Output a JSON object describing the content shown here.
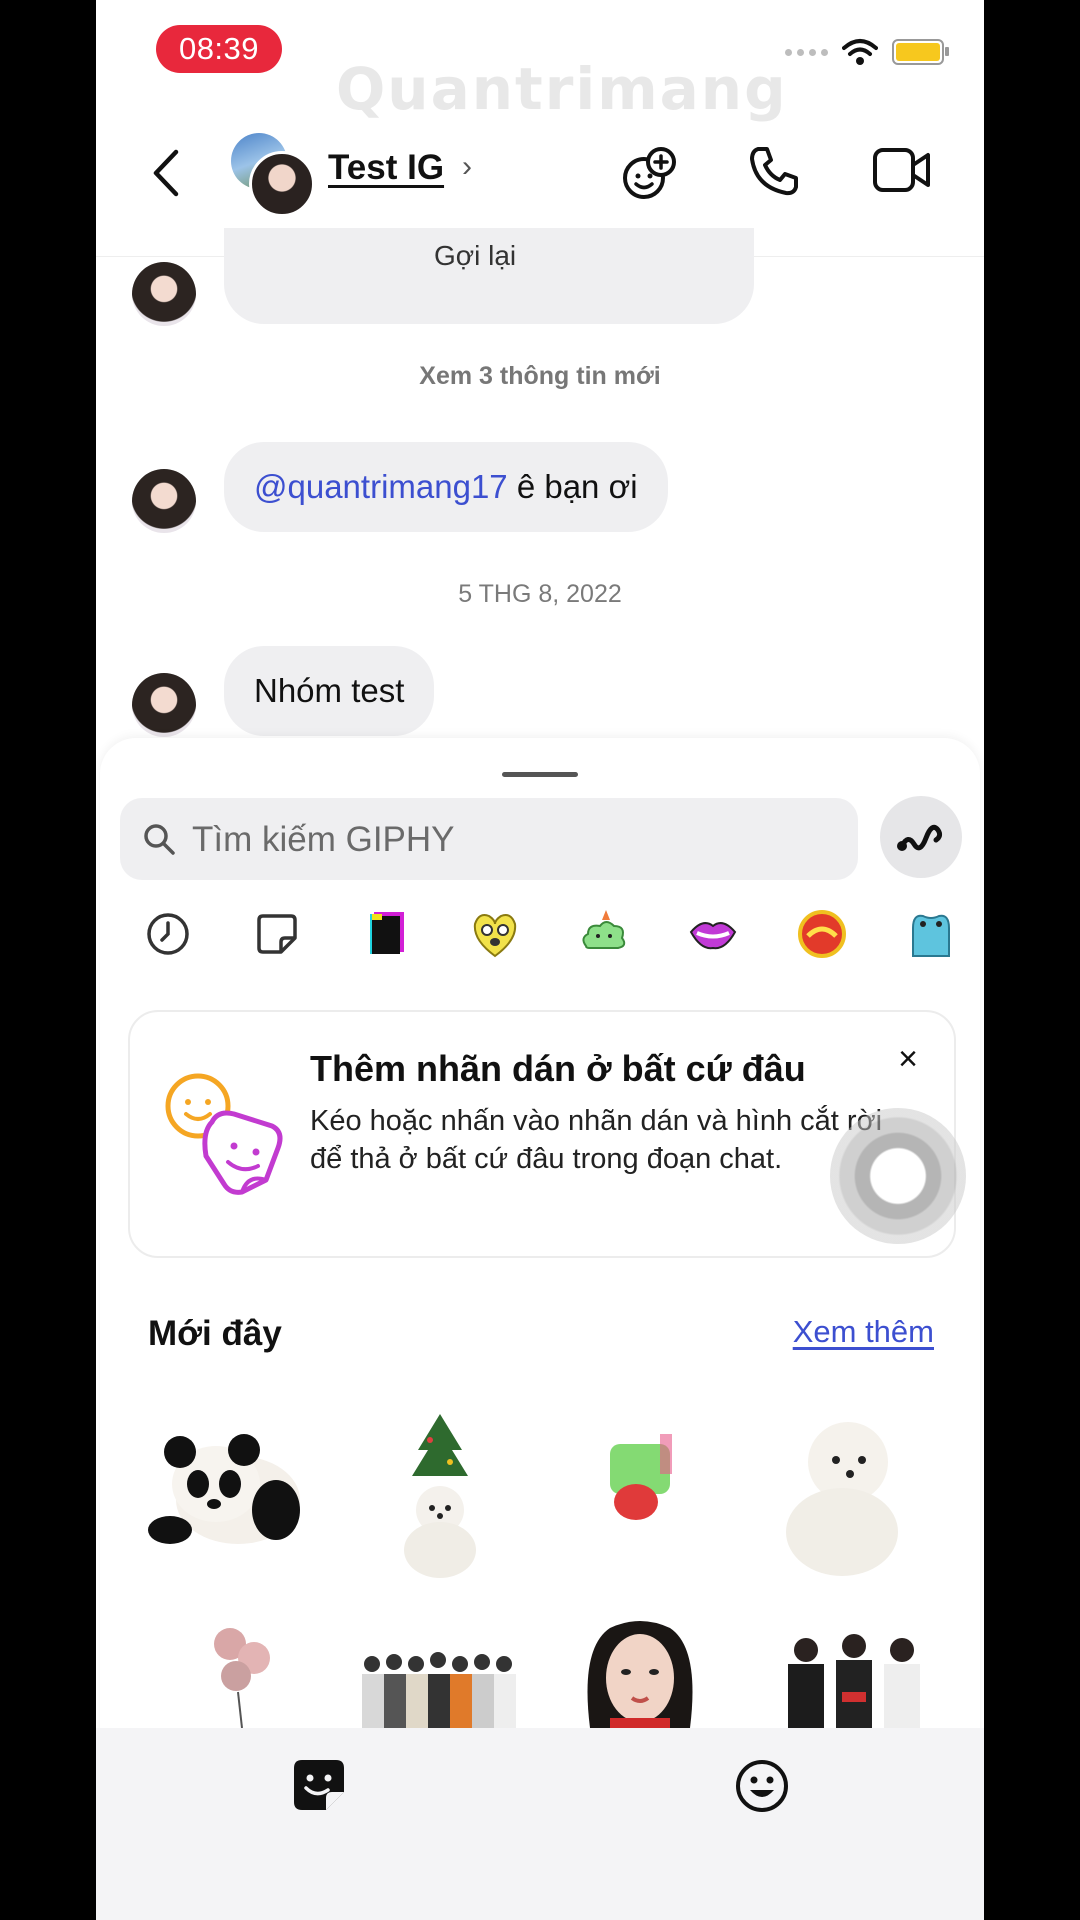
{
  "status_bar": {
    "time": "08:39"
  },
  "watermark": "Quantrimang",
  "header": {
    "title": "Test IG",
    "chevron": "›"
  },
  "messages": [
    {
      "partial_text": "Gợi lại"
    },
    {
      "system_text": "Xem 3 thông tin mới"
    },
    {
      "mention": "@quantrimang17",
      "text": " ê bạn ơi"
    },
    {
      "date": "5 THG 8, 2022"
    },
    {
      "text": "Nhóm test"
    }
  ],
  "sticker_sheet": {
    "search_placeholder": "Tìm kiếm GIPHY",
    "categories": [
      "recent-clock",
      "sticker",
      "black-card",
      "yellow-heart-face",
      "green-cloud",
      "purple-lips",
      "red-badge",
      "blue-frog"
    ],
    "tip": {
      "title": "Thêm nhãn dán ở bất cứ đâu",
      "description": "Kéo hoặc nhấn vào nhãn dán và hình cắt rời để thả ở bất cứ đâu trong đoạn chat.",
      "close": "×"
    },
    "recent_title": "Mới đây",
    "see_more": "Xem thêm",
    "stickers": [
      "panda",
      "puppy-with-tree",
      "green-strawberry",
      "white-puppy",
      "balloons",
      "group-photo",
      "girl-portrait",
      "suited-group"
    ]
  },
  "colors": {
    "accent": "#3c4fd0",
    "time_pill": "#e8283c",
    "bubble": "#efeff1"
  }
}
